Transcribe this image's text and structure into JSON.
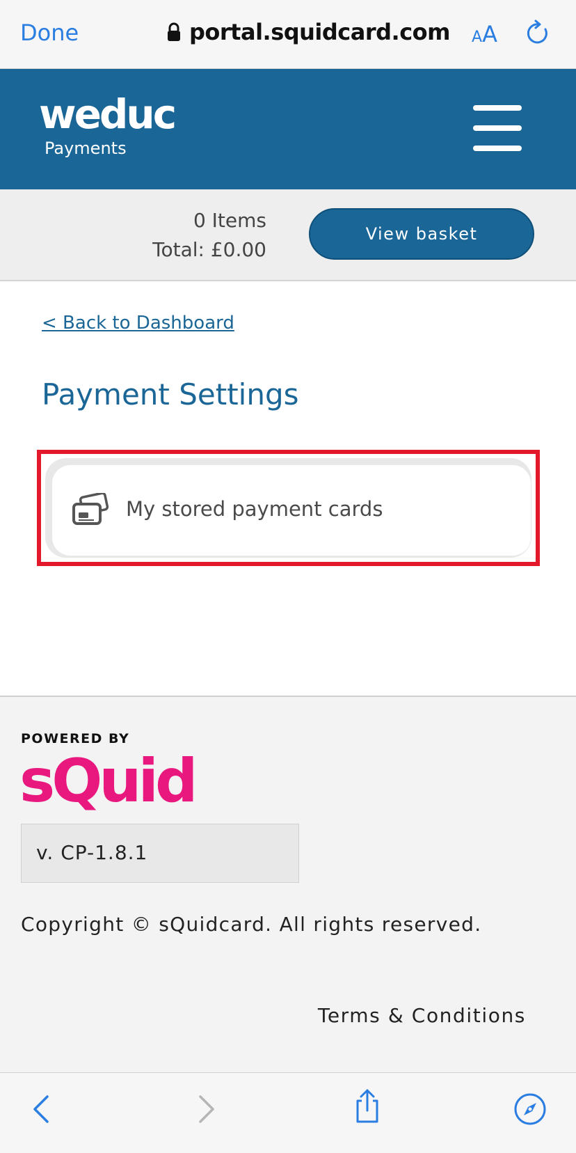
{
  "browser": {
    "done_label": "Done",
    "url": "portal.squidcard.com",
    "text_size_small": "A",
    "text_size_big": "A"
  },
  "header": {
    "logo_main": "weduc",
    "logo_sub": "Payments"
  },
  "basket": {
    "items": "0 Items",
    "total": "Total: £0.00",
    "view_label": "View basket"
  },
  "main": {
    "back_link": "< Back to Dashboard",
    "title": "Payment Settings",
    "options": [
      {
        "label": "My stored payment cards",
        "icon": "credit-cards-icon"
      }
    ]
  },
  "footer": {
    "powered_by": "POWERED BY",
    "brand": "sQuid",
    "version": "v. CP-1.8.1",
    "copyright": "Copyright © sQuidcard. All rights reserved.",
    "terms": "Terms & Conditions"
  },
  "colors": {
    "brand_blue": "#1a6697",
    "squid_pink": "#e8187f",
    "ios_blue": "#2a7de1",
    "highlight_red": "#e3182b"
  }
}
